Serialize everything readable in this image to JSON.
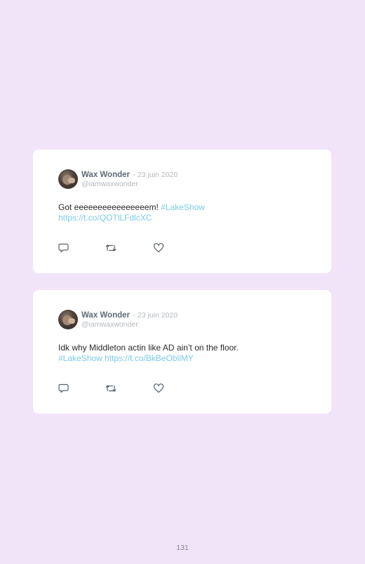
{
  "tweets": [
    {
      "author_name": "Wax Wonder",
      "date": "- 23 juin 2020",
      "handle": "@iamwaxwonder",
      "text_plain": "Got eeeeeeeeeeeeeeeem! ",
      "text_hashtag": "#LakeShow",
      "text_link": "https://t.co/QOTlLFdlcXC",
      "avatar_icon": "avatar-photo"
    },
    {
      "author_name": "Wax Wonder",
      "date": "- 23 juin 2020",
      "handle": "@iamwaxwonder",
      "text_plain": "Idk why Middleton actin like AD ain’t on the floor.",
      "text_hashtag": "#LakeShow",
      "text_link": "https://t.co/BkBeObliMY",
      "avatar_icon": "avatar-photo"
    }
  ],
  "icons": {
    "reply": "reply-icon",
    "retweet": "retweet-icon",
    "like": "like-icon"
  },
  "page_number": "131",
  "colors": {
    "background": "#f1e4f9",
    "card": "#ffffff",
    "link": "#7ccbea",
    "name": "#5f6b78",
    "meta": "#b4b8bd",
    "icon": "#55606b"
  }
}
